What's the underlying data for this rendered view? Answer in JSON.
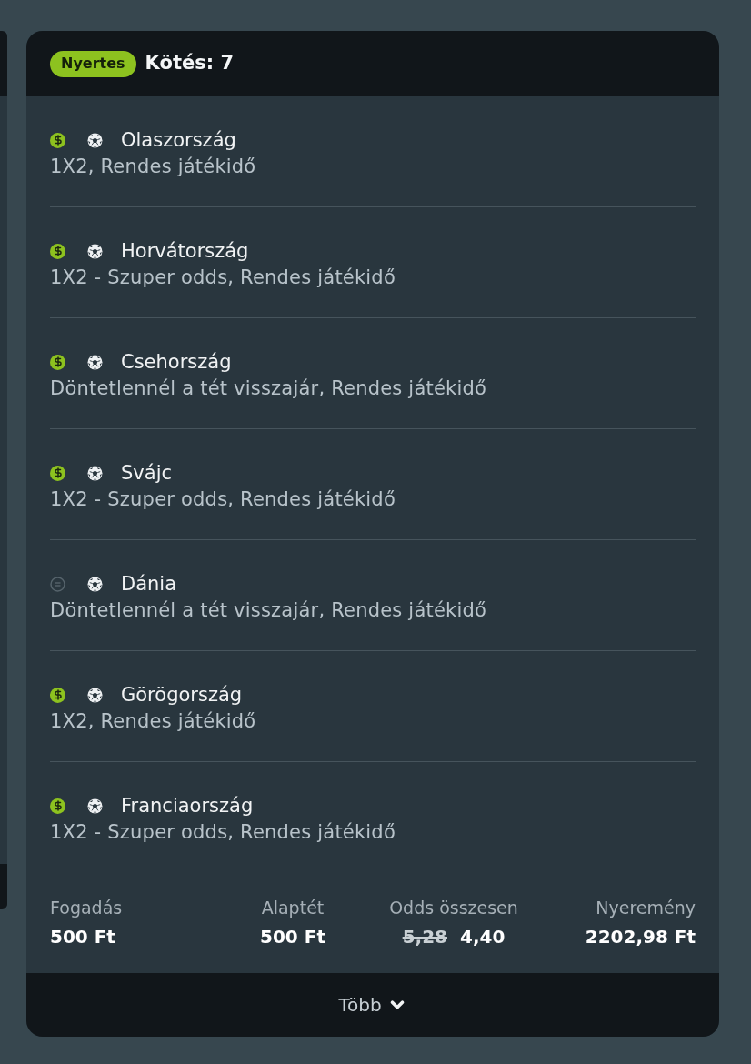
{
  "header": {
    "badge": {
      "label": "Nyertes",
      "kind": "won"
    },
    "title": "Kötés: 7"
  },
  "selections": [
    {
      "kind": "won",
      "team": "Olaszország",
      "market": "1X2, Rendes játékidő"
    },
    {
      "kind": "won",
      "team": "Horvátország",
      "market": "1X2 - Szuper odds, Rendes játékidő"
    },
    {
      "kind": "won",
      "team": "Csehország",
      "market": "Döntetlennél a tét visszajár, Rendes játékidő"
    },
    {
      "kind": "won",
      "team": "Svájc",
      "market": "1X2 - Szuper odds, Rendes játékidő"
    },
    {
      "kind": "void",
      "team": "Dánia",
      "market": "Döntetlennél a tét visszajár, Rendes játékidő"
    },
    {
      "kind": "won",
      "team": "Görögország",
      "market": "1X2, Rendes játékidő"
    },
    {
      "kind": "won",
      "team": "Franciaország",
      "market": "1X2 - Szuper odds, Rendes játékidő"
    }
  ],
  "summary": [
    {
      "label": "Fogadás",
      "value": "500 Ft"
    },
    {
      "label": "Alaptét",
      "value": "500 Ft"
    },
    {
      "label": "Odds összesen",
      "old_value": "5,28",
      "value": "4,40"
    },
    {
      "label": "Nyeremény",
      "value": "2202,98 Ft"
    }
  ],
  "more_button": {
    "label": "Több",
    "expanded": false
  }
}
